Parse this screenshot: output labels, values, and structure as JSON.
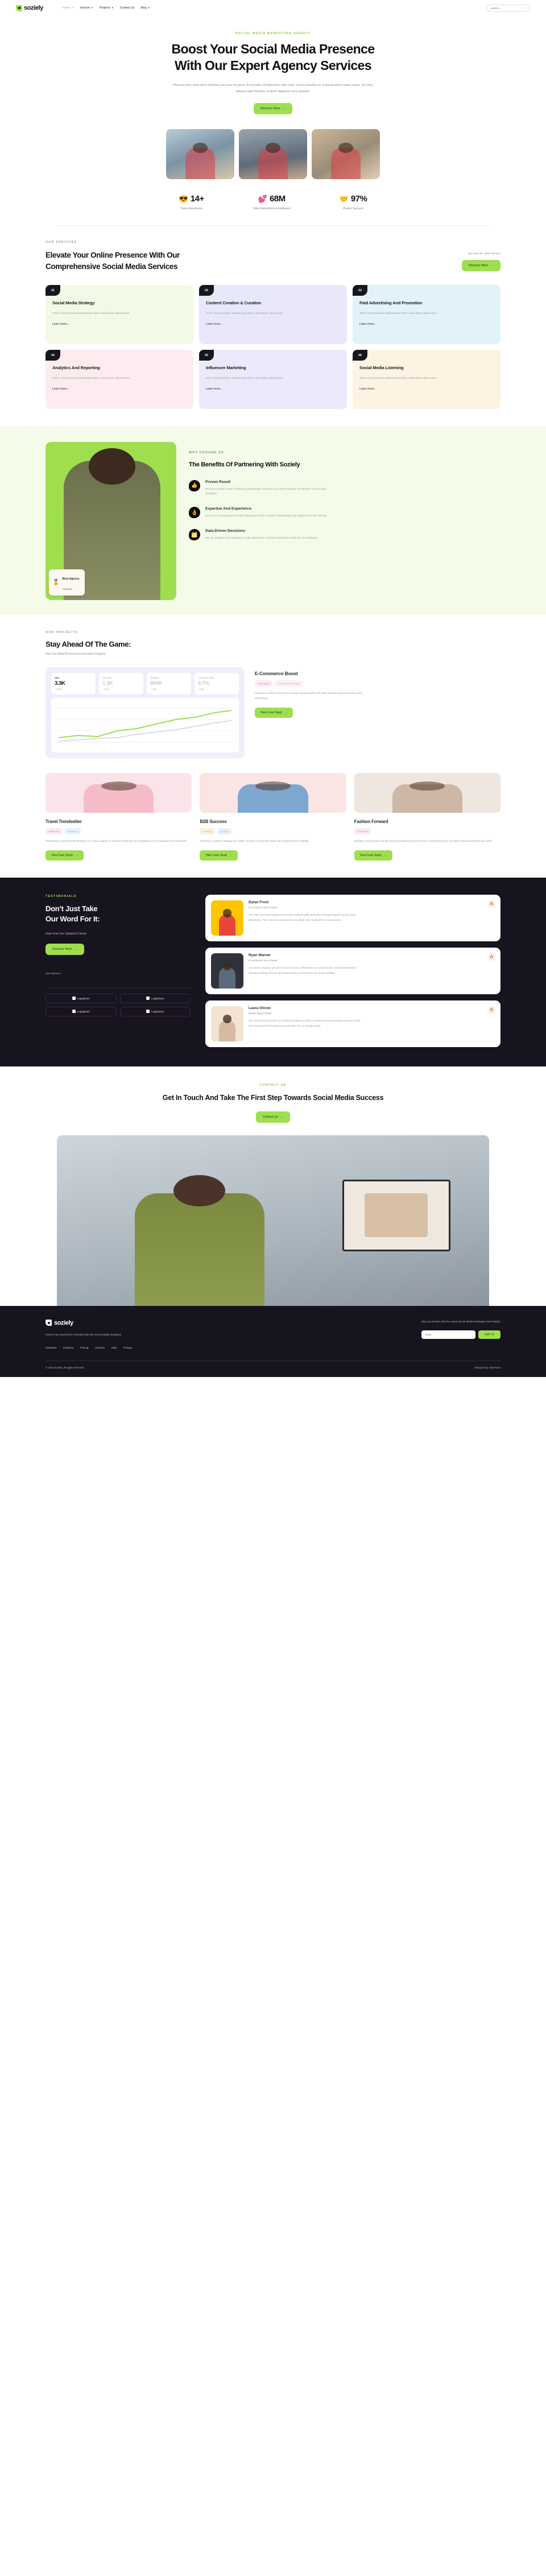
{
  "brand": {
    "name": "soziely"
  },
  "header": {
    "nav": [
      {
        "label": "Home",
        "caret": true,
        "active": true
      },
      {
        "label": "Service",
        "caret": true,
        "active": false
      },
      {
        "label": "Projects",
        "caret": true,
        "active": false
      },
      {
        "label": "Contact Us",
        "caret": false,
        "active": false
      },
      {
        "label": "Blog",
        "caret": true,
        "active": false
      }
    ],
    "search_placeholder": "search..."
  },
  "hero": {
    "eyebrow": "SOCIAL MEDIA MARKETING AGENCY",
    "title_line1": "Boost Your Social Media Presence",
    "title_line2": "With Our Expert Agency Services",
    "paragraph": "Placerat justo amet elit in tincidunt est risus vel purus. A convallis vel bibendum odio nunc. Lectus faucibus ac in ipsum amet nullam turpis. Vel vitae aliquam eget faucibus at libero dignissim arcu aliquam.",
    "cta": "Discover More"
  },
  "stats": [
    {
      "emoji": "😎",
      "value": "14+",
      "label": "Years Experience"
    },
    {
      "emoji": "💕",
      "value": "68M",
      "label": "Total Subscribers & Followers"
    },
    {
      "emoji": "🤝",
      "value": "97%",
      "label": "Project Success"
    }
  ],
  "services": {
    "eyebrow": "OUR SERVICES",
    "title": "Elevate Your Online Presence With Our Comprehensive Social Media Services",
    "note": "We have 26+ other services",
    "cta": "Discover More",
    "learn_more": "Learn more...",
    "body": "Tortor nisl elit pulvinar pellentesque libero varius libero ullamcorper.",
    "cards": [
      {
        "num": "01",
        "title": "Social Media Strategy",
        "color": "c-green"
      },
      {
        "num": "02",
        "title": "Content Creation & Curation",
        "color": "c-purple"
      },
      {
        "num": "03",
        "title": "Paid Advertising And Promotion",
        "color": "c-blue"
      },
      {
        "num": "04",
        "title": "Analytics And Reporting",
        "color": "c-pink"
      },
      {
        "num": "05",
        "title": "Influencer Marketing",
        "color": "c-lav"
      },
      {
        "num": "06",
        "title": "Social Media Listening",
        "color": "c-cream"
      }
    ]
  },
  "benefits": {
    "eyebrow": "WHY CHOOSE US",
    "title": "The Benefits Of Partnering With Soziely",
    "award_title": "Best Agency",
    "award_sub": "Awwards",
    "items": [
      {
        "emoji": "👍",
        "title": "Proven Result",
        "text": "We have a track record of delivering measurable results for our clients through our effective social media strategies."
      },
      {
        "emoji": "👌",
        "title": "Expertise And Experience",
        "text": "Our team is composed of social media experts with a wealth of knowledge and experience in the industry."
      },
      {
        "emoji": "🗂️",
        "title": "Data-Driven Decisions",
        "text": "We use analytics and reporting to make data-driven decisions that drive results for your business."
      }
    ]
  },
  "projects": {
    "eyebrow": "OUR PROJECTS",
    "title": "Stay Ahead Of The Game:",
    "subtitle": "See Our Most Recent and Innovative Projects",
    "cta": "View Case Study",
    "featured": {
      "title": "E-Commerce Boost",
      "tags": [
        {
          "label": "advertising",
          "cls": "t-pink"
        },
        {
          "label": "social media strategy",
          "cls": "t-pink2"
        }
      ],
      "text": "Helping an online retail store increase website traffic and sales through targeted social media advertising."
    },
    "dashboard": {
      "kpis": [
        {
          "label": "User",
          "value": "3.3K",
          "delta": "10.3%",
          "dir": "up",
          "active": true
        },
        {
          "label": "New User",
          "value": "1.3K",
          "delta": "6.2%",
          "dir": "down",
          "active": false
        },
        {
          "label": "Revenue",
          "value": "$84K",
          "delta": "7.6%",
          "dir": "up",
          "active": false
        },
        {
          "label": "Conversion Rate",
          "value": "0.7%",
          "delta": "5.5%",
          "dir": "down",
          "active": false
        }
      ]
    },
    "cards": [
      {
        "title": "Travel Trendsetter",
        "img": "pi1",
        "tags": [
          {
            "label": "instagram",
            "cls": "t-insta"
          },
          {
            "label": "facebook",
            "cls": "t-fb"
          }
        ],
        "text": "Developing a social media strategy for a travel agency to increase bookings and engagement on Instagram and Facebook"
      },
      {
        "title": "B2B Success",
        "img": "pi2",
        "tags": [
          {
            "label": "strategy",
            "cls": "t-strat"
          },
          {
            "label": "linkedin",
            "cls": "t-li"
          }
        ],
        "text": "Creating a LinkedIn strategy for a B2B company to generate leads and improve brand visibility"
      },
      {
        "title": "Fashion Forward",
        "img": "pi3",
        "tags": [
          {
            "label": "instagram",
            "cls": "t-insta"
          }
        ],
        "text": "Building a strong and visually stunning Instagram presence for a clothing brand to increase brand awareness and sales"
      }
    ]
  },
  "testimonials": {
    "eyebrow": "TESTIMONIALS",
    "title_line1": "Don’t Just Take",
    "title_line2": "Our Word For It:",
    "subtitle": "Hear from Our Satisfied Clients",
    "cta": "Discover More",
    "partners_heading": "Our Partners :",
    "partners": [
      "Logoipsum",
      "Logoipsum",
      "Logoipsum",
      "Logoipsum"
    ],
    "cards": [
      {
        "name": "Dylan Frost",
        "role": "E-commerce Store Owner",
        "avatar": "ta1",
        "badge": "🔥",
        "text": "The team at Soziely helped us increase website traffic and sales through targeted social media advertising. Their expertise and attention to detail were invaluable to our business."
      },
      {
        "name": "Ryan Warner",
        "role": "E-commerce Store Owner",
        "avatar": "ta2",
        "badge": "🔥",
        "text": "As a B2B company, we were unsure of how to effectively use social media. Soziely developed a LinkedIn strategy that has generated leads and improved our brand visibility."
      },
      {
        "name": "Laura Glover",
        "role": "Beauty Brand Owner",
        "avatar": "ta3",
        "badge": "🔥",
        "text": "The Soziely team's skills and creativity helped us build a visually stunning Instagram presence that has increased brand awareness and sales for our beauty brand."
      }
    ]
  },
  "contact": {
    "eyebrow": "CONTACT US",
    "title": "Get In Touch And Take The First Step Towards Social Media Success",
    "cta": "Contact Us"
  },
  "footer": {
    "tagline": "Unlock Your Business's Potential with Our Social Media Solutions",
    "links": [
      "Overview",
      "Features",
      "Pricing",
      "Careers",
      "Help",
      "Privacy"
    ],
    "newsletter_text": "Stay Up-to-Date with the Latest Social Media Strategies and Insights",
    "email_placeholder": "Enter...",
    "signup_label": "Sign Up",
    "copyright": "© 2023 Soziely. All rights reserved.",
    "credit": "Designed by TokoTema"
  },
  "colors": {
    "accent": "#9ede4f",
    "dark": "#17131f"
  }
}
